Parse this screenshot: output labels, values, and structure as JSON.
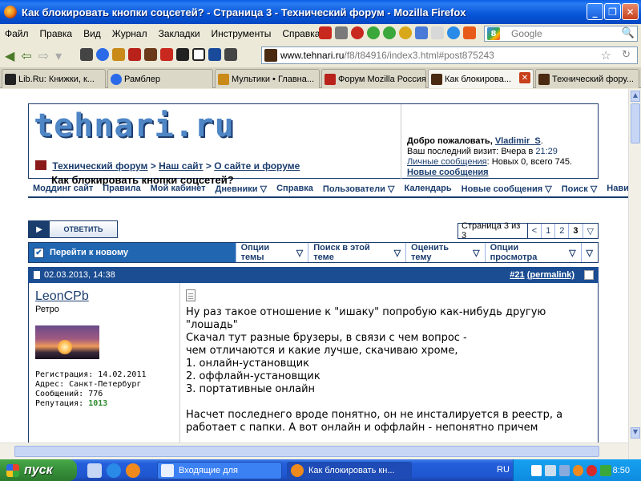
{
  "window": {
    "title": "Как блокировать кнопки соцсетей? - Страница 3 - Технический форум - Mozilla Firefox",
    "min_label": "_",
    "max_label": "❐",
    "close_label": "✕"
  },
  "menu": {
    "items": [
      "Файл",
      "Правка",
      "Вид",
      "Журнал",
      "Закладки",
      "Инструменты",
      "Справка"
    ],
    "search_placeholder": "Google",
    "search_engine_letter": "8"
  },
  "nav": {
    "url_host": "www.tehnari.ru",
    "url_path": "/f8/t84916/index3.html#post875243"
  },
  "tabs": [
    {
      "label": "Lib.Ru: Книжки, к...",
      "icon_color": "#222222"
    },
    {
      "label": "Рамблер",
      "icon_color": "#2a6ae8"
    },
    {
      "label": "Мультики • Главна...",
      "icon_color": "#c98a1a"
    },
    {
      "label": "Форум Mozilla Россия",
      "icon_color": "#b8221a"
    },
    {
      "label": "Как блокирова...",
      "icon_color": "#4a2a10",
      "active": true
    },
    {
      "label": "Технический фору...",
      "icon_color": "#4a2a10"
    }
  ],
  "site": {
    "logo": "tehnari.ru",
    "breadcrumb": [
      "Технический форум",
      "Наш сайт",
      "О сайте и форуме"
    ],
    "breadcrumb_sep": ">",
    "current_thread": "Как блокировать кнопки соцсетей?",
    "welcome": {
      "greeting": "Добро пожаловать,",
      "username": "Vladimir_S",
      "last_visit_label": "Ваш последний визит: Вчера в",
      "last_visit_time": "21:29",
      "pm_link": "Личные сообщения",
      "pm_info": ": Новых 0, всего 745.",
      "new_posts": "Новые сообщения"
    },
    "navstrip": [
      "Моддинг сайт",
      "Правила",
      "Мой кабинет",
      "Дневники",
      "Справка",
      "Пользователи",
      "Календарь",
      "Новые сообщения",
      "Поиск",
      "Навигац"
    ],
    "reply_label": "ответить",
    "pager": {
      "info": "Страница 3 из 3",
      "prev": "<",
      "pages": [
        "1",
        "2",
        "3"
      ],
      "current": "3",
      "dd": "▽"
    },
    "toolbar": {
      "first": "Перейти к новому",
      "options": [
        "Опции темы",
        "Поиск в этой теме",
        "Оценить тему",
        "Опции просмотра"
      ]
    }
  },
  "post": {
    "date": "02.03.2013, 14:38",
    "number": "#21",
    "permalink": "(permalink)",
    "author": {
      "name": "LeonCPb",
      "title": "Ретро",
      "reg_label": "Регистрация:",
      "reg_date": "14.02.2011",
      "addr_label": "Адрес:",
      "addr": "Санкт-Петербург",
      "posts_label": "Сообщений:",
      "posts": "776",
      "rep_label": "Репутация:",
      "rep": "1013"
    },
    "lines": [
      "Ну раз такое отношение к \"ишаку\" попробую как-нибудь другую",
      "\"лошадь\"",
      "Скачал тут разные брузеры, в связи с чем вопрос -",
      "чем отличаются и какие лучше, скачиваю хроме,",
      "1. онлайн-установщик",
      "2. оффлайн-установщик",
      "3. портативные онлайн",
      "",
      "Насчет последнего вроде понятно, он не инсталируется в реестр, а",
      "работает с папки. А вот онлайн и оффлайн - непонятно причем"
    ]
  },
  "taskbar": {
    "start_label": "пуск",
    "tasks": [
      {
        "label": "Входящие для",
        "icon_color": "#e8f0ff"
      },
      {
        "label": "Как блокировать кн...",
        "icon_color": "#f08a1c"
      }
    ],
    "lang": "RU",
    "clock": "8:50"
  }
}
